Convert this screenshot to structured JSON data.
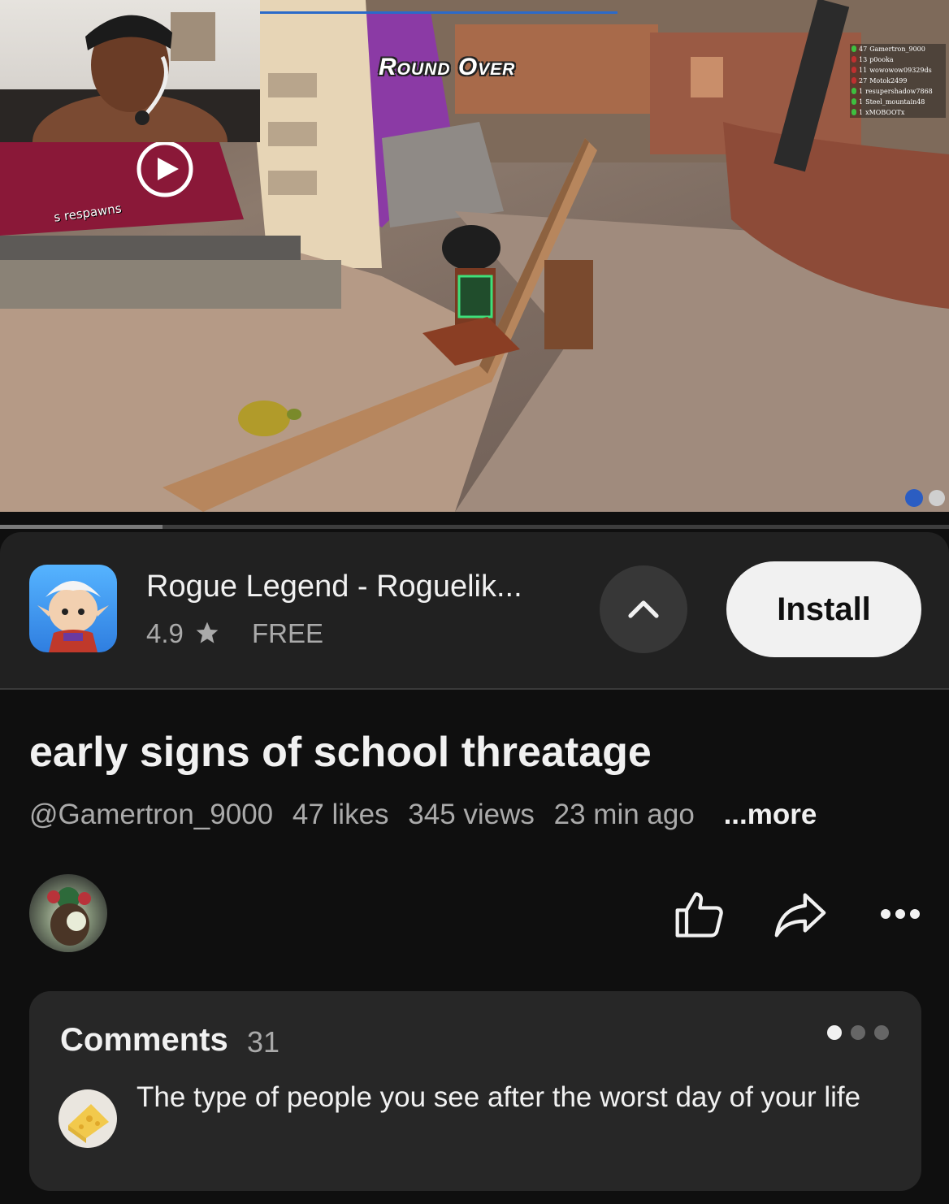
{
  "video": {
    "overlay_text": "Round Over",
    "sign_text": "s respawns",
    "leaderboard": [
      {
        "score": "47",
        "name": "Gamertron_9000",
        "marker": "green"
      },
      {
        "score": "13",
        "name": "p0ooka",
        "marker": "red"
      },
      {
        "score": "11",
        "name": "wowowow09329ds",
        "marker": "red"
      },
      {
        "score": "27",
        "name": "Motok2499",
        "marker": "red"
      },
      {
        "score": "1",
        "name": "resupershadow7868",
        "marker": "green"
      },
      {
        "score": "1",
        "name": "Steel_mountain48",
        "marker": "green"
      },
      {
        "score": "1",
        "name": "xMOBOOTx",
        "marker": "green"
      }
    ]
  },
  "ad": {
    "app_name": "Rogue Legend - Roguelik...",
    "rating": "4.9",
    "star_icon": "star-icon",
    "price": "FREE",
    "install_label": "Install",
    "collapse_icon": "chevron-up-icon"
  },
  "video_info": {
    "title": "early signs of school threatage",
    "channel": "@Gamertron_9000",
    "likes": "47 likes",
    "views": "345 views",
    "age": "23 min ago",
    "more_label": "...more"
  },
  "actions": {
    "like_icon": "thumbs-up-icon",
    "share_icon": "share-icon",
    "more_icon": "more-horizontal-icon"
  },
  "comments": {
    "label": "Comments",
    "count": "31",
    "pager_dots": 3,
    "active_dot": 0,
    "top_comment": "The type of people you see after the worst day of your life"
  },
  "colors": {
    "background": "#0f0f0f",
    "card": "#212121",
    "comments_card": "#272727",
    "install_bg": "#f1f1f1",
    "secondary_text": "#aaaaaa"
  }
}
